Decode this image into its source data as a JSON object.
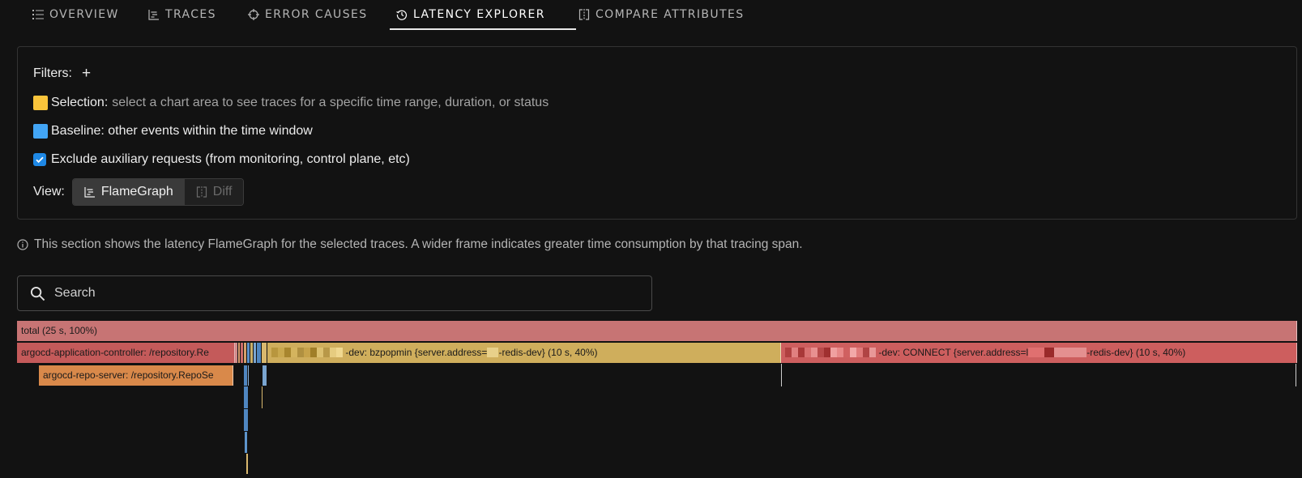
{
  "tabs": [
    {
      "label": "OVERVIEW",
      "icon": "list-icon"
    },
    {
      "label": "TRACES",
      "icon": "traces-icon"
    },
    {
      "label": "ERROR CAUSES",
      "icon": "crosshair-icon"
    },
    {
      "label": "LATENCY EXPLORER",
      "icon": "clock-history-icon",
      "active": true
    },
    {
      "label": "COMPARE ATTRIBUTES",
      "icon": "compare-icon"
    }
  ],
  "filters": {
    "label": "Filters:",
    "add": "+",
    "selection_label": "Selection:",
    "selection_text": "select a chart area to see traces for a specific time range, duration, or status",
    "baseline_label": "Baseline: other events within the time window",
    "exclude_label": "Exclude auxiliary requests (from monitoring, control plane, etc)",
    "exclude_checked": true,
    "view_label": "View:",
    "view_options": [
      "FlameGraph",
      "Diff"
    ],
    "view_selected": "FlameGraph"
  },
  "colors": {
    "selection": "#f9c43b",
    "baseline": "#42a5f5",
    "accent": "#1e88e5",
    "frame_total": "#c77474",
    "frame_controller": "#c45a5a",
    "frame_repo": "#d9894a",
    "frame_bzpopmin": "#cfae5c",
    "frame_connect": "#cd5e5e"
  },
  "info": "This section shows the latency FlameGraph for the selected traces. A wider frame indicates greater time consumption by that tracing span.",
  "search": {
    "placeholder": "Search",
    "value": ""
  },
  "flamegraph": {
    "total": "total (25 s, 100%)",
    "controller": "argocd-application-controller: /repository.Re",
    "repo_server": "argocd-repo-server: /repository.RepoSe",
    "bzpopmin_a": "-dev: bzpopmin {server.address=",
    "bzpopmin_b": "-redis-dev} (10 s, 40%)",
    "connect_a": "-dev: CONNECT {server.address=l",
    "connect_b": "-redis-dev} (10 s, 40%)"
  }
}
